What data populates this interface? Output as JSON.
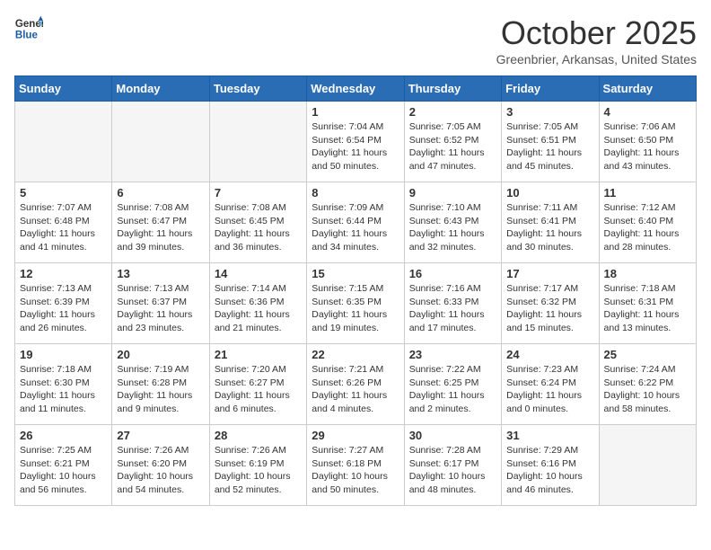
{
  "header": {
    "logo_line1": "General",
    "logo_line2": "Blue",
    "title": "October 2025",
    "subtitle": "Greenbrier, Arkansas, United States"
  },
  "columns": [
    "Sunday",
    "Monday",
    "Tuesday",
    "Wednesday",
    "Thursday",
    "Friday",
    "Saturday"
  ],
  "rows": [
    [
      {
        "day": "",
        "info": ""
      },
      {
        "day": "",
        "info": ""
      },
      {
        "day": "",
        "info": ""
      },
      {
        "day": "1",
        "info": "Sunrise: 7:04 AM\nSunset: 6:54 PM\nDaylight: 11 hours and 50 minutes."
      },
      {
        "day": "2",
        "info": "Sunrise: 7:05 AM\nSunset: 6:52 PM\nDaylight: 11 hours and 47 minutes."
      },
      {
        "day": "3",
        "info": "Sunrise: 7:05 AM\nSunset: 6:51 PM\nDaylight: 11 hours and 45 minutes."
      },
      {
        "day": "4",
        "info": "Sunrise: 7:06 AM\nSunset: 6:50 PM\nDaylight: 11 hours and 43 minutes."
      }
    ],
    [
      {
        "day": "5",
        "info": "Sunrise: 7:07 AM\nSunset: 6:48 PM\nDaylight: 11 hours and 41 minutes."
      },
      {
        "day": "6",
        "info": "Sunrise: 7:08 AM\nSunset: 6:47 PM\nDaylight: 11 hours and 39 minutes."
      },
      {
        "day": "7",
        "info": "Sunrise: 7:08 AM\nSunset: 6:45 PM\nDaylight: 11 hours and 36 minutes."
      },
      {
        "day": "8",
        "info": "Sunrise: 7:09 AM\nSunset: 6:44 PM\nDaylight: 11 hours and 34 minutes."
      },
      {
        "day": "9",
        "info": "Sunrise: 7:10 AM\nSunset: 6:43 PM\nDaylight: 11 hours and 32 minutes."
      },
      {
        "day": "10",
        "info": "Sunrise: 7:11 AM\nSunset: 6:41 PM\nDaylight: 11 hours and 30 minutes."
      },
      {
        "day": "11",
        "info": "Sunrise: 7:12 AM\nSunset: 6:40 PM\nDaylight: 11 hours and 28 minutes."
      }
    ],
    [
      {
        "day": "12",
        "info": "Sunrise: 7:13 AM\nSunset: 6:39 PM\nDaylight: 11 hours and 26 minutes."
      },
      {
        "day": "13",
        "info": "Sunrise: 7:13 AM\nSunset: 6:37 PM\nDaylight: 11 hours and 23 minutes."
      },
      {
        "day": "14",
        "info": "Sunrise: 7:14 AM\nSunset: 6:36 PM\nDaylight: 11 hours and 21 minutes."
      },
      {
        "day": "15",
        "info": "Sunrise: 7:15 AM\nSunset: 6:35 PM\nDaylight: 11 hours and 19 minutes."
      },
      {
        "day": "16",
        "info": "Sunrise: 7:16 AM\nSunset: 6:33 PM\nDaylight: 11 hours and 17 minutes."
      },
      {
        "day": "17",
        "info": "Sunrise: 7:17 AM\nSunset: 6:32 PM\nDaylight: 11 hours and 15 minutes."
      },
      {
        "day": "18",
        "info": "Sunrise: 7:18 AM\nSunset: 6:31 PM\nDaylight: 11 hours and 13 minutes."
      }
    ],
    [
      {
        "day": "19",
        "info": "Sunrise: 7:18 AM\nSunset: 6:30 PM\nDaylight: 11 hours and 11 minutes."
      },
      {
        "day": "20",
        "info": "Sunrise: 7:19 AM\nSunset: 6:28 PM\nDaylight: 11 hours and 9 minutes."
      },
      {
        "day": "21",
        "info": "Sunrise: 7:20 AM\nSunset: 6:27 PM\nDaylight: 11 hours and 6 minutes."
      },
      {
        "day": "22",
        "info": "Sunrise: 7:21 AM\nSunset: 6:26 PM\nDaylight: 11 hours and 4 minutes."
      },
      {
        "day": "23",
        "info": "Sunrise: 7:22 AM\nSunset: 6:25 PM\nDaylight: 11 hours and 2 minutes."
      },
      {
        "day": "24",
        "info": "Sunrise: 7:23 AM\nSunset: 6:24 PM\nDaylight: 11 hours and 0 minutes."
      },
      {
        "day": "25",
        "info": "Sunrise: 7:24 AM\nSunset: 6:22 PM\nDaylight: 10 hours and 58 minutes."
      }
    ],
    [
      {
        "day": "26",
        "info": "Sunrise: 7:25 AM\nSunset: 6:21 PM\nDaylight: 10 hours and 56 minutes."
      },
      {
        "day": "27",
        "info": "Sunrise: 7:26 AM\nSunset: 6:20 PM\nDaylight: 10 hours and 54 minutes."
      },
      {
        "day": "28",
        "info": "Sunrise: 7:26 AM\nSunset: 6:19 PM\nDaylight: 10 hours and 52 minutes."
      },
      {
        "day": "29",
        "info": "Sunrise: 7:27 AM\nSunset: 6:18 PM\nDaylight: 10 hours and 50 minutes."
      },
      {
        "day": "30",
        "info": "Sunrise: 7:28 AM\nSunset: 6:17 PM\nDaylight: 10 hours and 48 minutes."
      },
      {
        "day": "31",
        "info": "Sunrise: 7:29 AM\nSunset: 6:16 PM\nDaylight: 10 hours and 46 minutes."
      },
      {
        "day": "",
        "info": ""
      }
    ]
  ]
}
